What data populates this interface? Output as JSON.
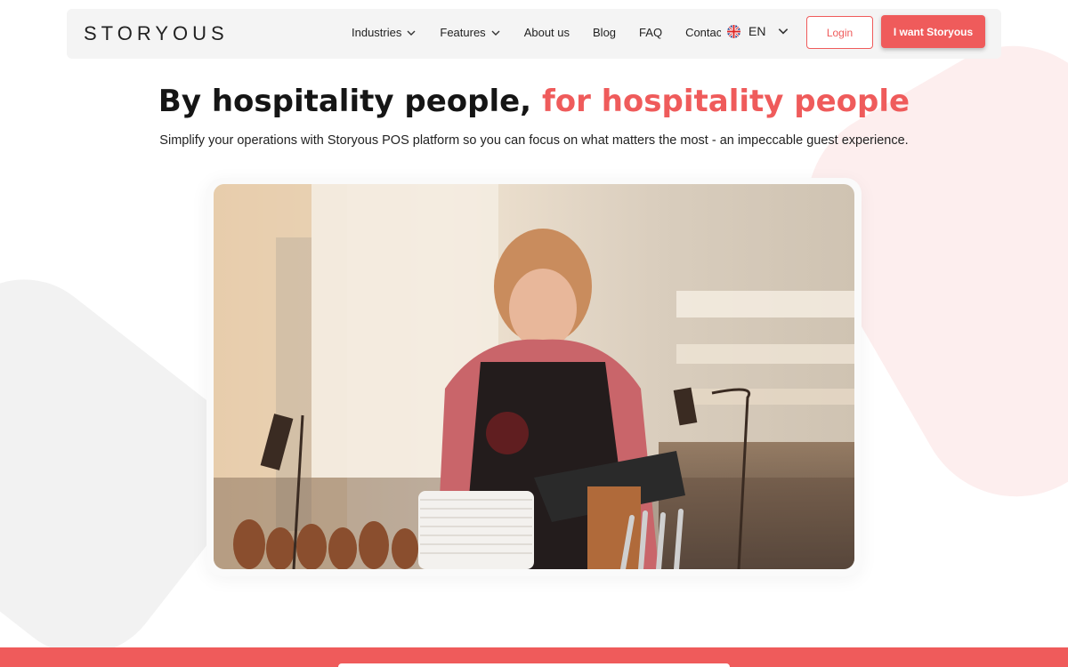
{
  "brand": {
    "logo_text": "STORYOUS"
  },
  "nav": {
    "items": [
      {
        "label": "Industries",
        "has_dropdown": true
      },
      {
        "label": "Features",
        "has_dropdown": true
      },
      {
        "label": "About us",
        "has_dropdown": false
      },
      {
        "label": "Blog",
        "has_dropdown": false
      },
      {
        "label": "FAQ",
        "has_dropdown": false
      },
      {
        "label": "Contac",
        "has_dropdown": false
      }
    ],
    "language": {
      "code": "EN",
      "flag_icon": "uk-flag-icon"
    },
    "login_label": "Login",
    "cta_label": "I want Storyous"
  },
  "hero": {
    "title_plain": "By hospitality people,",
    "title_accent": "for hospitality people",
    "subtitle": "Simplify your operations with Storyous POS platform so you can focus on what matters the most - an impeccable guest experience."
  },
  "colors": {
    "accent": "#ef5b5b",
    "header_bg": "#f4f4f4",
    "text": "#151515"
  }
}
